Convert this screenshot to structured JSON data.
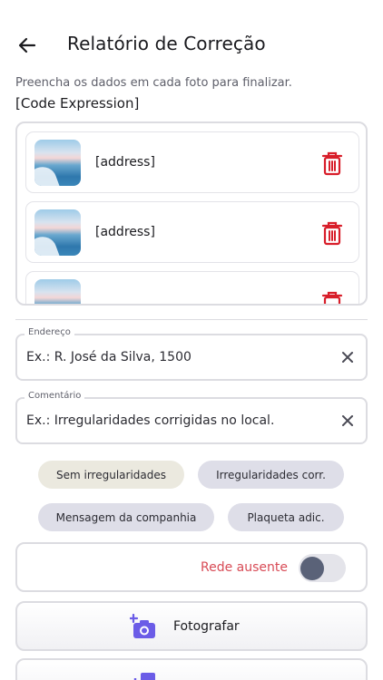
{
  "header": {
    "title": "Relatório de Correção"
  },
  "intro": {
    "subtitle": "Preencha os dados em cada foto para finalizar.",
    "code_expression": "[Code Expression]"
  },
  "photos": [
    {
      "address": "[address]"
    },
    {
      "address": "[address]"
    },
    {
      "address": ""
    }
  ],
  "address_field": {
    "label": "Endereço",
    "placeholder": "Ex.: R. José da Silva, 1500"
  },
  "comment_field": {
    "label": "Comentário",
    "placeholder": "Ex.: Irregularidades corrigidas no local."
  },
  "chips": [
    {
      "label": "Sem irregularidades",
      "selected": true
    },
    {
      "label": "Irregularidades corr.",
      "selected": false
    },
    {
      "label": "Mensagem da companhia",
      "selected": false
    },
    {
      "label": "Plaqueta adic.",
      "selected": false
    }
  ],
  "network": {
    "label": "Rede ausente",
    "on": false
  },
  "actions": {
    "photograph_label": "Fotografar"
  },
  "colors": {
    "accent": "#6b5ce7",
    "danger": "#d81e2a",
    "warning_text": "#d84b56",
    "border": "#dcdce1"
  }
}
